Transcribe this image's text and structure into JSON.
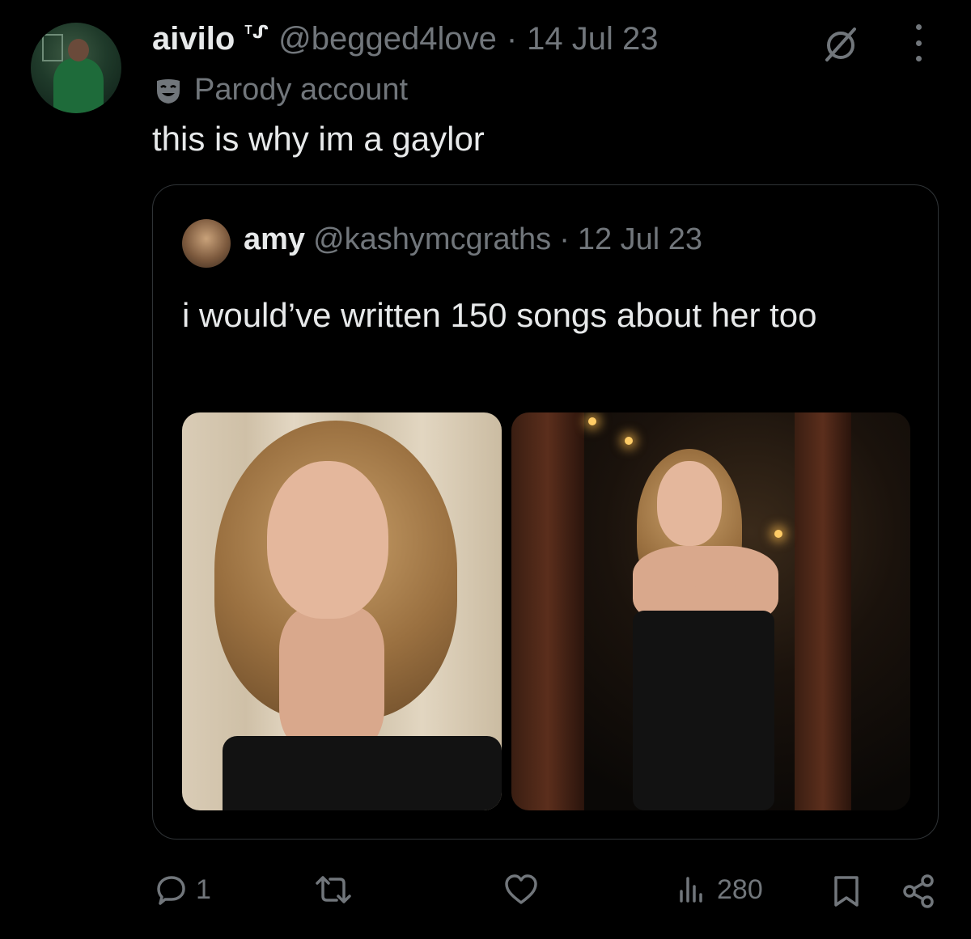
{
  "tweet": {
    "author_name": "aivilo",
    "author_suffix": "ᵀᔑ",
    "handle": "@begged4love",
    "separator": "·",
    "date": "14 Jul 23",
    "label": "Parody account",
    "text": "this is why im a gaylor"
  },
  "quoted_tweet": {
    "author_name": "amy",
    "handle": "@kashymcgraths",
    "separator": "·",
    "date": "12 Jul 23",
    "text": "i would’ve written 150 songs about her too",
    "photos": [
      "portrait-photo",
      "event-photo"
    ]
  },
  "actions": {
    "reply_count": "1",
    "retweet_count": "",
    "like_count": "",
    "views_count": "280"
  },
  "colors": {
    "background": "#000000",
    "text_primary": "#e7e9ea",
    "text_secondary": "#71767b",
    "border": "#2f3336"
  },
  "icons": [
    "grok-icon",
    "more-icon",
    "parody-mask-icon",
    "reply-icon",
    "retweet-icon",
    "like-icon",
    "views-icon",
    "bookmark-icon",
    "share-icon"
  ]
}
